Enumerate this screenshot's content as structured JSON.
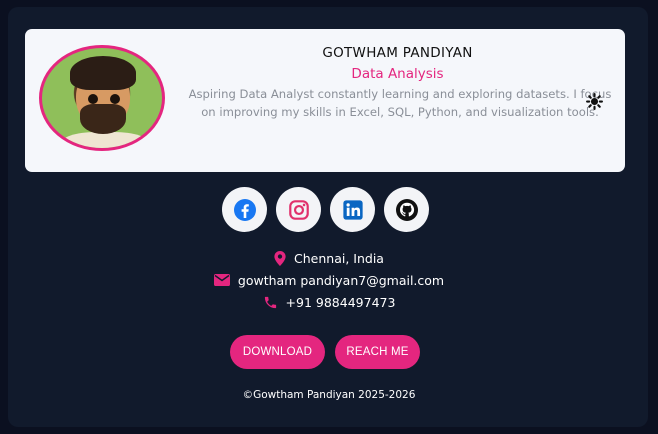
{
  "profile": {
    "name": "GOTWHAM PANDIYAN",
    "role": "Data Analysis",
    "bio": "Aspiring Data Analyst constantly learning and exploring datasets. I focus on improving my skills in Excel, SQL, Python, and visualization tools."
  },
  "socials": [
    {
      "name": "facebook",
      "icon": "facebook-icon",
      "color": "#1877f2"
    },
    {
      "name": "instagram",
      "icon": "instagram-icon",
      "color": "#e1306c"
    },
    {
      "name": "linkedin",
      "icon": "linkedin-icon",
      "color": "#0a66c2"
    },
    {
      "name": "github",
      "icon": "github-icon",
      "color": "#111111"
    }
  ],
  "contact": {
    "location": "Chennai, India",
    "email": "gowtham pandiyan7@gmail.com",
    "phone": "+91 9884497473"
  },
  "buttons": {
    "download": "DOWNLOAD",
    "reach": "REACH ME"
  },
  "footer": "©Gowtham Pandiyan 2025-2026",
  "colors": {
    "accent": "#e4267f",
    "background": "#0b1020",
    "panel": "#111a2c",
    "card": "#f5f7fb"
  }
}
